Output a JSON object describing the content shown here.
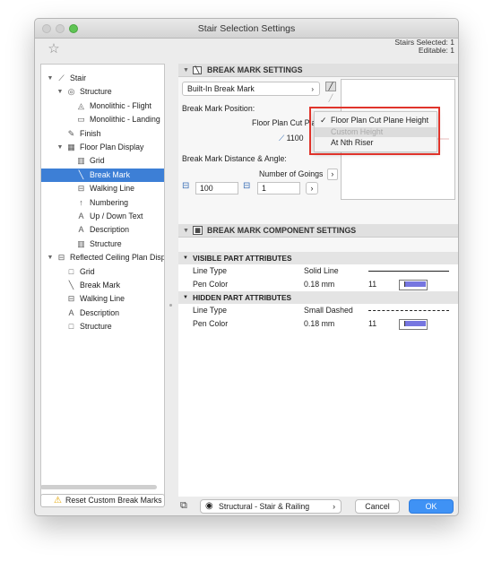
{
  "window": {
    "title": "Stair Selection Settings"
  },
  "selection": {
    "stairs_selected": "Stairs Selected: 1",
    "editable": "Editable: 1"
  },
  "tree": [
    {
      "label": "Stair",
      "level": 0,
      "expanded": true,
      "icon": "stair-icon"
    },
    {
      "label": "Structure",
      "level": 1,
      "expanded": true,
      "icon": "structure-icon"
    },
    {
      "label": "Monolithic - Flight",
      "level": 2,
      "icon": "flight-icon"
    },
    {
      "label": "Monolithic - Landing",
      "level": 2,
      "icon": "landing-icon"
    },
    {
      "label": "Finish",
      "level": 1,
      "icon": "finish-icon"
    },
    {
      "label": "Floor Plan Display",
      "level": 1,
      "expanded": true,
      "icon": "floor-plan-icon"
    },
    {
      "label": "Grid",
      "level": 2,
      "icon": "grid-icon"
    },
    {
      "label": "Break Mark",
      "level": 2,
      "selected": true,
      "icon": "break-mark-icon"
    },
    {
      "label": "Walking Line",
      "level": 2,
      "icon": "walking-line-icon"
    },
    {
      "label": "Numbering",
      "level": 2,
      "icon": "numbering-icon"
    },
    {
      "label": "Up / Down Text",
      "level": 2,
      "icon": "text-icon"
    },
    {
      "label": "Description",
      "level": 2,
      "icon": "text-icon"
    },
    {
      "label": "Structure",
      "level": 2,
      "icon": "structure-grid-icon"
    },
    {
      "label": "Reflected Ceiling Plan Displ",
      "level": 0,
      "expanded": true,
      "icon": "ceiling-plan-icon"
    },
    {
      "label": "Grid",
      "level": 1,
      "icon": "grid-box-icon"
    },
    {
      "label": "Break Mark",
      "level": 1,
      "icon": "break-mark-icon"
    },
    {
      "label": "Walking Line",
      "level": 1,
      "icon": "walking-line-icon"
    },
    {
      "label": "Description",
      "level": 1,
      "icon": "text-icon"
    },
    {
      "label": "Structure",
      "level": 1,
      "icon": "grid-box-icon"
    }
  ],
  "reset_button": "Reset Custom Break Marks",
  "break_mark_settings": {
    "header": "BREAK MARK SETTINGS",
    "type_popup": "Built-In Break Mark",
    "position_label": "Break Mark Position:",
    "position_value": "Floor Plan Cut Plane Height",
    "height_value": "1100",
    "distance_angle_label": "Break Mark Distance & Angle:",
    "goings_popup": "Number of Goings",
    "distance_value": "100",
    "goings_value": "1"
  },
  "dropdown": {
    "items": [
      {
        "label": "Floor Plan Cut Plane Height",
        "checked": true
      },
      {
        "label": "Custom Height",
        "disabled": true
      },
      {
        "label": "At Nth Riser"
      }
    ]
  },
  "component_settings": {
    "header": "BREAK MARK COMPONENT SETTINGS",
    "visible": {
      "header": "VISIBLE PART ATTRIBUTES",
      "line_type_label": "Line Type",
      "line_type_value": "Solid Line",
      "pen_color_label": "Pen Color",
      "pen_size": "0.18 mm",
      "pen_number": "11"
    },
    "hidden": {
      "header": "HIDDEN PART ATTRIBUTES",
      "line_type_label": "Line Type",
      "line_type_value": "Small Dashed",
      "pen_color_label": "Pen Color",
      "pen_size": "0.18 mm",
      "pen_number": "11"
    }
  },
  "bottom": {
    "layer_popup": "Structural - Stair & Railing",
    "cancel": "Cancel",
    "ok": "OK"
  },
  "colors": {
    "selection": "#3d7fd6",
    "accent_button": "#3f92f5",
    "highlight_box": "#e0342b",
    "pen_swatch": "#7676e0"
  }
}
